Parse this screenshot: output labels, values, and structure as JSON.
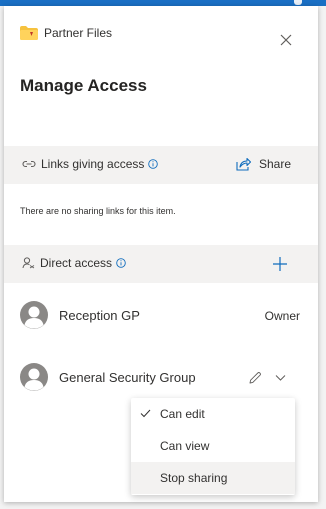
{
  "header": {
    "folder_name": "Partner Files",
    "title": "Manage Access"
  },
  "links_section": {
    "label": "Links giving access",
    "share_label": "Share",
    "empty_message": "There are no sharing links for this item."
  },
  "direct_section": {
    "label": "Direct access"
  },
  "people": [
    {
      "name": "Reception GP",
      "role": "Owner"
    },
    {
      "name": "General Security Group"
    }
  ],
  "permission_menu": {
    "items": [
      {
        "label": "Can edit",
        "checked": true
      },
      {
        "label": "Can view",
        "checked": false
      },
      {
        "label": "Stop sharing",
        "checked": false,
        "hovered": true
      }
    ]
  },
  "colors": {
    "accent": "#1a6fc4",
    "folder": "#f6c23e",
    "section_bg": "#f3f2f1"
  }
}
